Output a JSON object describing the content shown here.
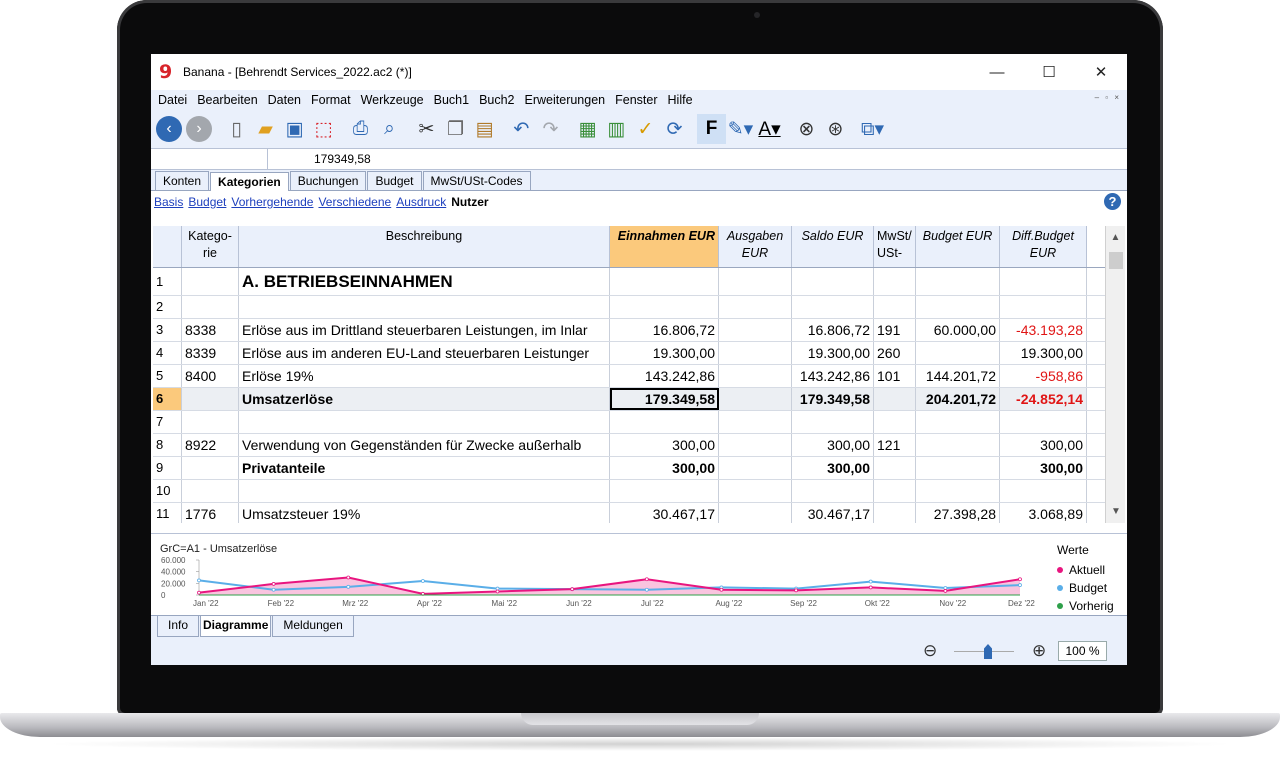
{
  "window": {
    "app_icon": "9",
    "title": "Banana - [Behrendt Services_2022.ac2 (*)]",
    "minimize": "—",
    "maximize": "☐",
    "close": "✕"
  },
  "menu": [
    "Datei",
    "Bearbeiten",
    "Daten",
    "Format",
    "Werkzeuge",
    "Buch1",
    "Buch2",
    "Erweiterungen",
    "Fenster",
    "Hilfe"
  ],
  "mdi_controls": "– ▫ ×",
  "toolbar_icons": [
    "back-icon",
    "forward-icon",
    "new-file-icon",
    "open-folder-icon",
    "save-icon",
    "pdf-icon",
    "print-icon",
    "preview-icon",
    "cut-icon",
    "copy-icon",
    "paste-icon",
    "undo-icon",
    "redo-icon",
    "insert-row-icon",
    "delete-row-icon",
    "check-icon",
    "recalculate-icon",
    "bold-icon",
    "highlight-icon",
    "font-color-icon",
    "find-icon",
    "replace-icon",
    "window-icon"
  ],
  "formula_bar": {
    "cell_ref": "",
    "value": "179349,58"
  },
  "tabs": [
    "Konten",
    "Kategorien",
    "Buchungen",
    "Budget",
    "MwSt/USt-Codes"
  ],
  "active_tab": "Kategorien",
  "views": [
    "Basis",
    "Budget",
    "Vorhergehende",
    "Verschiedene",
    "Ausdruck",
    "Nutzer"
  ],
  "active_view": "Nutzer",
  "help": "?",
  "columns": {
    "rn": "",
    "kategorie": "Katego-\nrie",
    "beschreibung": "Beschreibung",
    "einnahmen": "Einnahmen EUR",
    "ausgaben": "Ausgaben EUR",
    "saldo": "Saldo EUR",
    "mwst": "MwSt/\nUSt-",
    "budget": "Budget EUR",
    "diff": "Diff.Budget EUR"
  },
  "rows": [
    {
      "rn": "1",
      "kat": "",
      "desc": "A. BETRIEBSEINNAHMEN",
      "ein": "",
      "aus": "",
      "sal": "",
      "mw": "",
      "bud": "",
      "dif": "",
      "style": "h1"
    },
    {
      "rn": "2",
      "kat": "",
      "desc": "",
      "ein": "",
      "aus": "",
      "sal": "",
      "mw": "",
      "bud": "",
      "dif": ""
    },
    {
      "rn": "3",
      "kat": "8338",
      "desc": "Erlöse aus im Drittland steuerbaren Leistungen, im Inlar",
      "ein": "16.806,72",
      "aus": "",
      "sal": "16.806,72",
      "mw": "191",
      "bud": "60.000,00",
      "dif": "-43.193,28"
    },
    {
      "rn": "4",
      "kat": "8339",
      "desc": "Erlöse aus im anderen EU-Land steuerbaren Leistunger",
      "ein": "19.300,00",
      "aus": "",
      "sal": "19.300,00",
      "mw": "260",
      "bud": "",
      "dif": "19.300,00"
    },
    {
      "rn": "5",
      "kat": "8400",
      "desc": "Erlöse 19%",
      "ein": "143.242,86",
      "aus": "",
      "sal": "143.242,86",
      "mw": "101",
      "bud": "144.201,72",
      "dif": "-958,86"
    },
    {
      "rn": "6",
      "kat": "",
      "desc": "Umsatzerlöse",
      "ein": "179.349,58",
      "aus": "",
      "sal": "179.349,58",
      "mw": "",
      "bud": "204.201,72",
      "dif": "-24.852,14",
      "style": "total"
    },
    {
      "rn": "7",
      "kat": "",
      "desc": "",
      "ein": "",
      "aus": "",
      "sal": "",
      "mw": "",
      "bud": "",
      "dif": ""
    },
    {
      "rn": "8",
      "kat": "8922",
      "desc": "Verwendung von Gegenständen für Zwecke außerhalb",
      "ein": "300,00",
      "aus": "",
      "sal": "300,00",
      "mw": "121",
      "bud": "",
      "dif": "300,00"
    },
    {
      "rn": "9",
      "kat": "",
      "desc": "Privatanteile",
      "ein": "300,00",
      "aus": "",
      "sal": "300,00",
      "mw": "",
      "bud": "",
      "dif": "300,00",
      "style": "bold"
    },
    {
      "rn": "10",
      "kat": "",
      "desc": "",
      "ein": "",
      "aus": "",
      "sal": "",
      "mw": "",
      "bud": "",
      "dif": ""
    },
    {
      "rn": "11",
      "kat": "1776",
      "desc": "Umsatzsteuer 19%",
      "ein": "30.467,17",
      "aus": "",
      "sal": "30.467,17",
      "mw": "",
      "bud": "27.398,28",
      "dif": "3.068,89"
    }
  ],
  "chart": {
    "title": "GrC=A1 - Umsatzerlöse",
    "legend_title": "Werte",
    "series_colors": {
      "Aktuell": "#e8157f",
      "Budget": "#5aaee8",
      "Vorherig": "#2ea04a"
    },
    "legend": [
      "Aktuell",
      "Budget",
      "Vorherig"
    ]
  },
  "chart_data": {
    "type": "area",
    "title": "GrC=A1 - Umsatzerlöse",
    "categories": [
      "Jan '22",
      "Feb '22",
      "Mrz '22",
      "Apr '22",
      "Mai '22",
      "Jun '22",
      "Jul '22",
      "Aug '22",
      "Sep '22",
      "Okt '22",
      "Nov '22",
      "Dez '22"
    ],
    "yticks": [
      "60.000",
      "40.000",
      "20.000",
      "0"
    ],
    "ylim": [
      0,
      60000
    ],
    "series": [
      {
        "name": "Aktuell",
        "values": [
          4000,
          19000,
          30000,
          2000,
          6000,
          10000,
          27000,
          9000,
          8000,
          13000,
          7000,
          27000
        ]
      },
      {
        "name": "Budget",
        "values": [
          25000,
          9000,
          14000,
          24000,
          11000,
          10000,
          9000,
          13000,
          11000,
          23000,
          12000,
          17000
        ]
      },
      {
        "name": "Vorherig",
        "values": [
          0,
          0,
          0,
          0,
          0,
          0,
          0,
          0,
          0,
          0,
          0,
          0
        ]
      }
    ],
    "legend": "right"
  },
  "bottom_tabs": [
    "Info",
    "Diagramme",
    "Meldungen"
  ],
  "active_bottom_tab": "Diagramme",
  "zoom": {
    "out": "⊖",
    "in": "⊕",
    "level": "100 %",
    "slider_fraction": 0.5
  }
}
